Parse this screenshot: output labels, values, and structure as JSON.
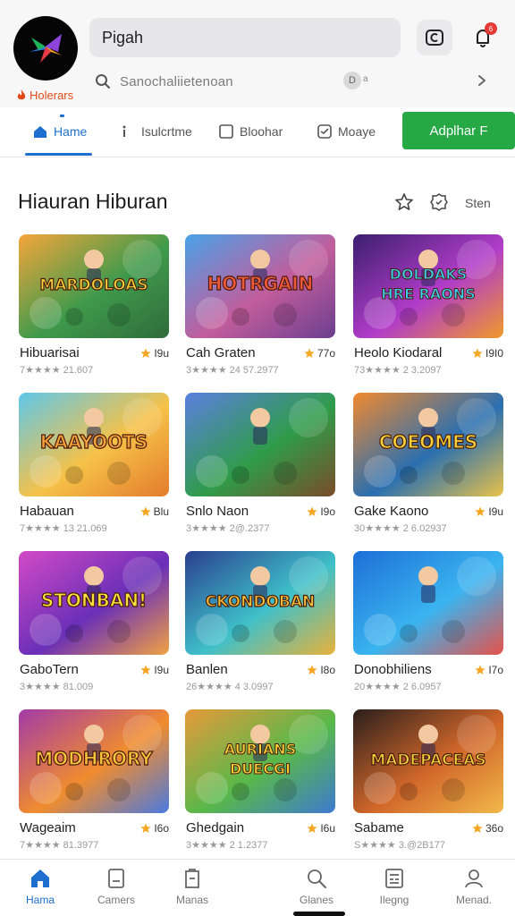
{
  "header": {
    "brand_label": "Holerars",
    "search_value": "Pigah",
    "subsearch_text": "Sanochaliietenoan",
    "subsearch_chip": "D",
    "subsearch_chip_extra": "a",
    "notification_count": "6",
    "icons": {
      "logo": "app-logo-icon",
      "cast": "cast-icon",
      "notifications": "bell-icon",
      "search": "search-icon",
      "chevron": "chevron-right-icon"
    }
  },
  "nav": {
    "tabs": [
      {
        "label": "Hame",
        "icon": "home-icon",
        "active": true
      },
      {
        "label": "Isulcrtme",
        "icon": "info-icon",
        "active": false
      },
      {
        "label": "Bloohar",
        "icon": "square-icon",
        "active": false
      },
      {
        "label": "Moaye",
        "icon": "chat-icon",
        "active": false
      }
    ],
    "apply_label": "Adplhar F"
  },
  "section": {
    "title": "Hiauran Hiburan",
    "more_label": "Sten",
    "icons": [
      "star-outline-icon",
      "badge-icon"
    ]
  },
  "games": [
    {
      "title": "Hibuarisai",
      "rating": "I9u",
      "sub": "7★★★★ 21.607",
      "thumb_text": "MARDOLOAS"
    },
    {
      "title": "Cah Graten",
      "rating": "77o",
      "sub": "3★★★★ 24 57.2977",
      "thumb_text": "HOTRGAIN"
    },
    {
      "title": "Heolo Kiodaral",
      "rating": "I9I0",
      "sub": "73★★★★ 2 3.2097",
      "thumb_text": "DOLDAKS HRE RAONS"
    },
    {
      "title": "Habauan",
      "rating": "Blu",
      "sub": "7★★★★ 13 21.069",
      "thumb_text": "KAAYOOTS"
    },
    {
      "title": "Snlo Naon",
      "rating": "I9o",
      "sub": "3★★★★ 2@.2377",
      "thumb_text": ""
    },
    {
      "title": "Gake Kaono",
      "rating": "I9u",
      "sub": "30★★★★ 2 6.02937",
      "thumb_text": "COEOMES"
    },
    {
      "title": "GaboTern",
      "rating": "I9u",
      "sub": "3★★★★ 81.009",
      "thumb_text": "STONBAN!"
    },
    {
      "title": "Banlen",
      "rating": "I8o",
      "sub": "26★★★★ 4 3.0997",
      "thumb_text": "CKONDOBAN"
    },
    {
      "title": "Donobhiliens",
      "rating": "I7o",
      "sub": "20★★★★ 2 6.0957",
      "thumb_text": ""
    },
    {
      "title": "Wageaim",
      "rating": "I6o",
      "sub": "7★★★★ 81.3977",
      "thumb_text": "MODHRORY"
    },
    {
      "title": "Ghedgain",
      "rating": "I6u",
      "sub": "3★★★★ 2 1.2377",
      "thumb_text": "AURIANS DUECGI"
    },
    {
      "title": "Sabame",
      "rating": "36o",
      "sub": "S★★★★ 3.@2B177",
      "thumb_text": "MADEPACEAS"
    }
  ],
  "bottom_nav": [
    {
      "label": "Hama",
      "icon": "home-icon",
      "active": true
    },
    {
      "label": "Camers",
      "icon": "document-icon",
      "active": false
    },
    {
      "label": "Manas",
      "icon": "clipboard-icon",
      "active": false
    },
    {
      "label": "Glanes",
      "icon": "search-icon",
      "active": false
    },
    {
      "label": "Ilegng",
      "icon": "grid-list-icon",
      "active": false
    },
    {
      "label": "Menad.",
      "icon": "profile-icon",
      "active": false
    }
  ],
  "colors": {
    "accent_blue": "#1f6fd1",
    "apply_green": "#26a845",
    "star_orange": "#f5a623",
    "brand_orange": "#e04a18",
    "badge_red": "#e53935"
  }
}
